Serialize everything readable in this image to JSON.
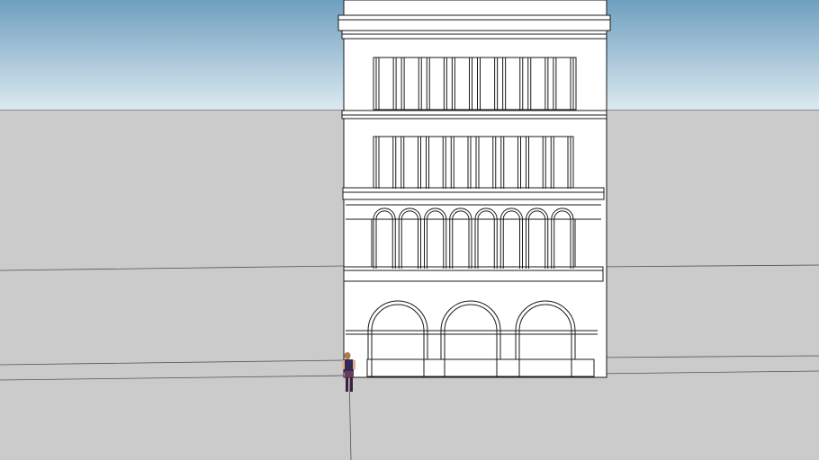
{
  "viewport": {
    "sky_top_color": "#6f9fbf",
    "sky_bottom_color": "#dceaf0",
    "ground_color": "#cbcbcb",
    "facade_color": "#ffffff",
    "line_color": "#1a1a1a"
  },
  "scene": {
    "upper_window_bays": 8,
    "arched_window_bays": 8,
    "ground_floor_arches": 3,
    "figure_clothing_color": "#2e2a55",
    "figure_hair_color": "#b07a45"
  }
}
